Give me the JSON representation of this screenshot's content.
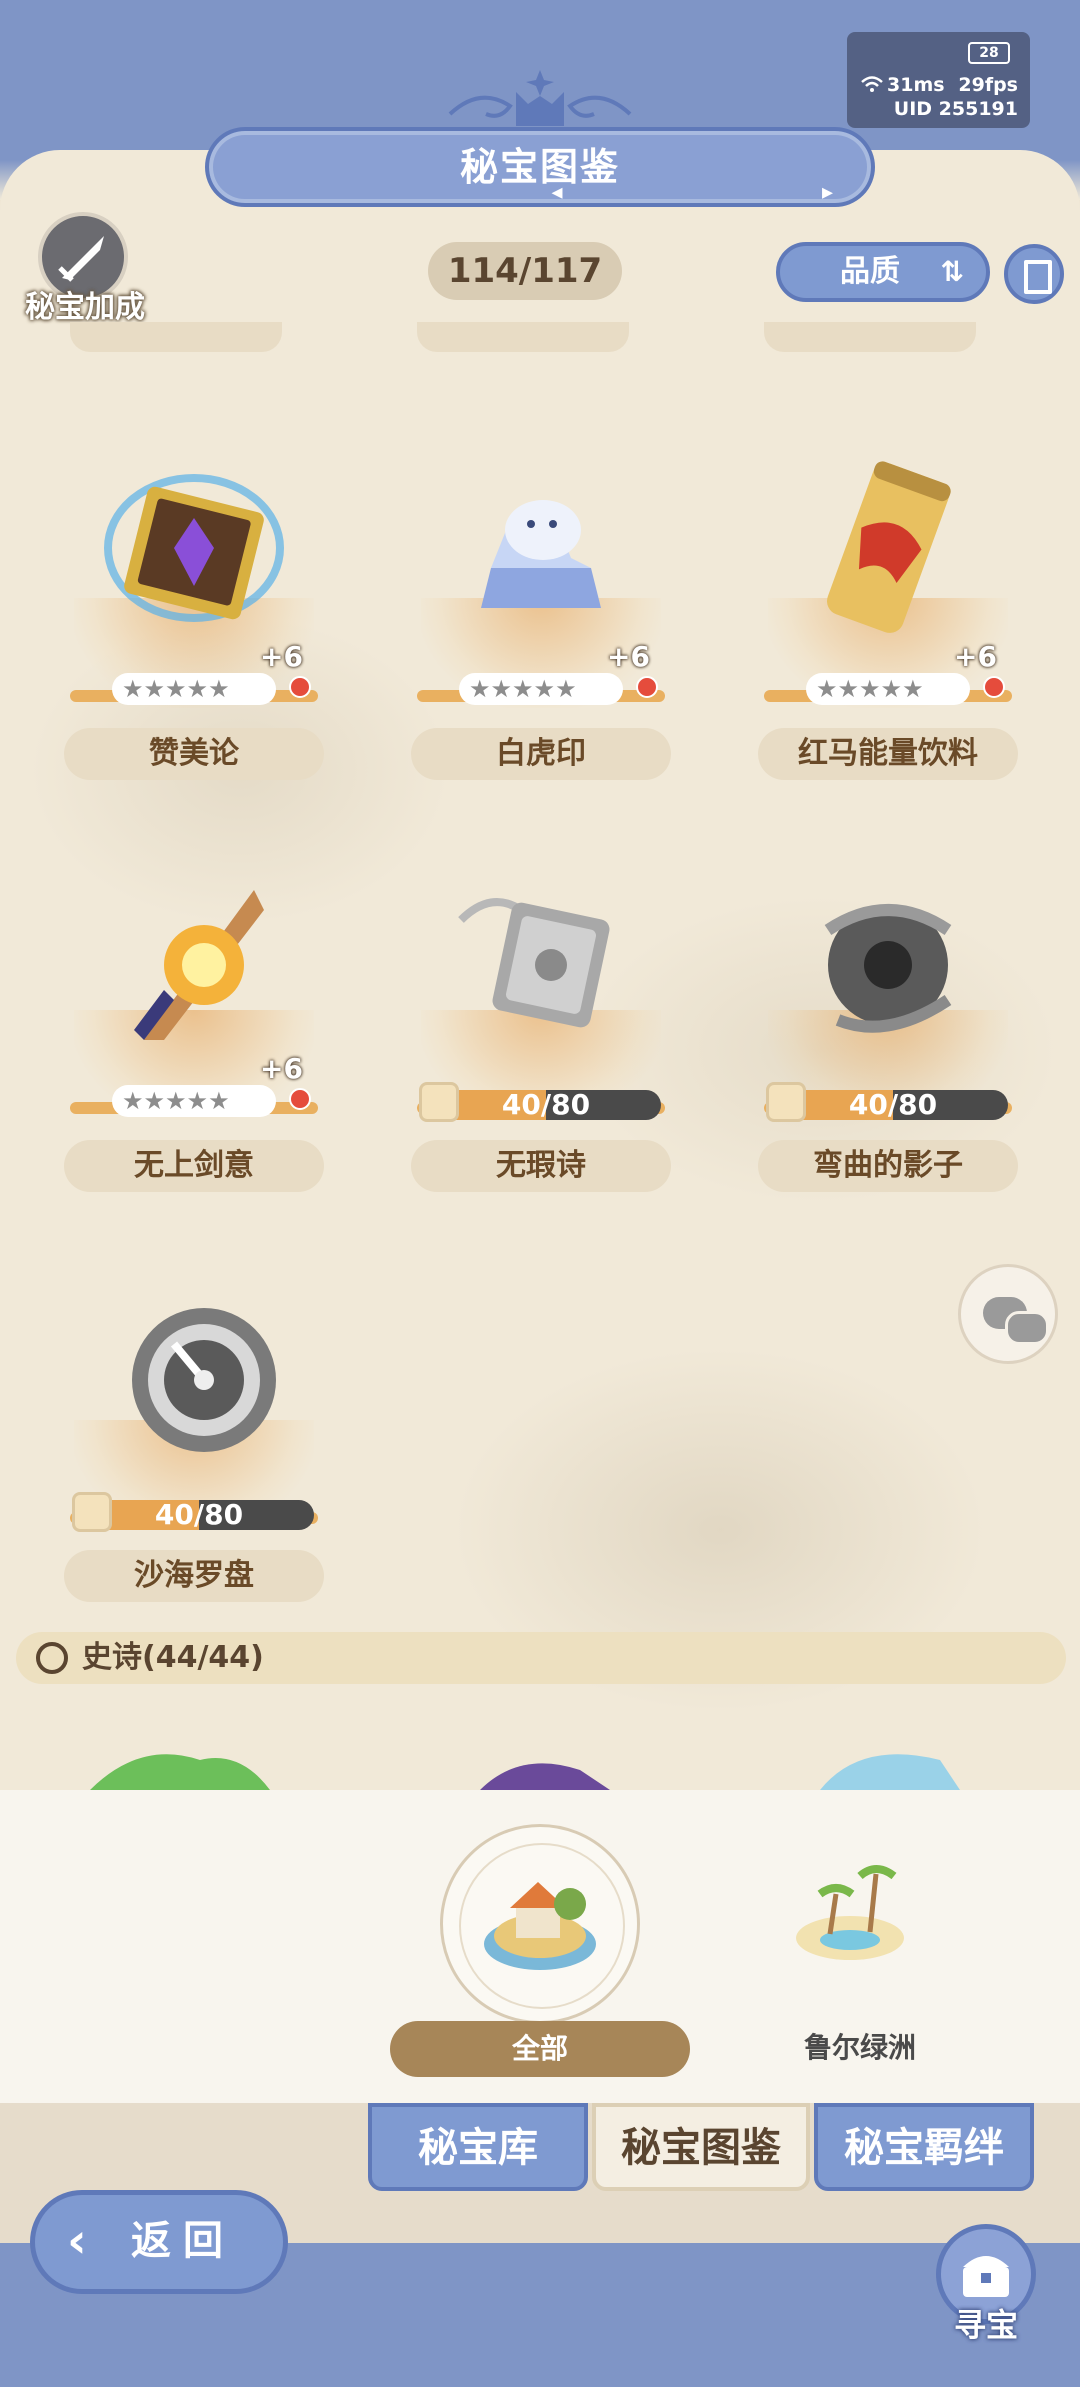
{
  "status": {
    "battery": "28",
    "ping": "31ms",
    "fps": "29fps",
    "uid": "UID  255191"
  },
  "header": {
    "title": "秘宝图鉴",
    "bonus_label": "秘宝加成",
    "count": "114/117",
    "sort_label": "品质"
  },
  "items": [
    {
      "name": "赞美论",
      "plus": "+6",
      "stars": "★★★★★"
    },
    {
      "name": "白虎印",
      "plus": "+6",
      "stars": "★★★★★"
    },
    {
      "name": "红马能量饮料",
      "plus": "+6",
      "stars": "★★★★★"
    },
    {
      "name": "无上剑意",
      "plus": "+6",
      "stars": "★★★★★"
    },
    {
      "name": "无瑕诗",
      "progress": "40/80",
      "fraction": 0.5
    },
    {
      "name": "弯曲的影子",
      "progress": "40/80",
      "fraction": 0.5
    },
    {
      "name": "沙海罗盘",
      "progress": "40/80",
      "fraction": 0.5
    }
  ],
  "section": {
    "label": "史诗(44/44)"
  },
  "regions": {
    "all_label": "全部",
    "oasis_label": "鲁尔绿洲"
  },
  "tabs": [
    "秘宝库",
    "秘宝图鉴",
    "秘宝羁绊"
  ],
  "bottom": {
    "back_label": "返回",
    "treasure_label": "寻宝"
  },
  "colors": {
    "accent_blue": "#7f9ad1",
    "pedestal_orange": "#e9b060",
    "badge_red": "#e54c3c"
  }
}
